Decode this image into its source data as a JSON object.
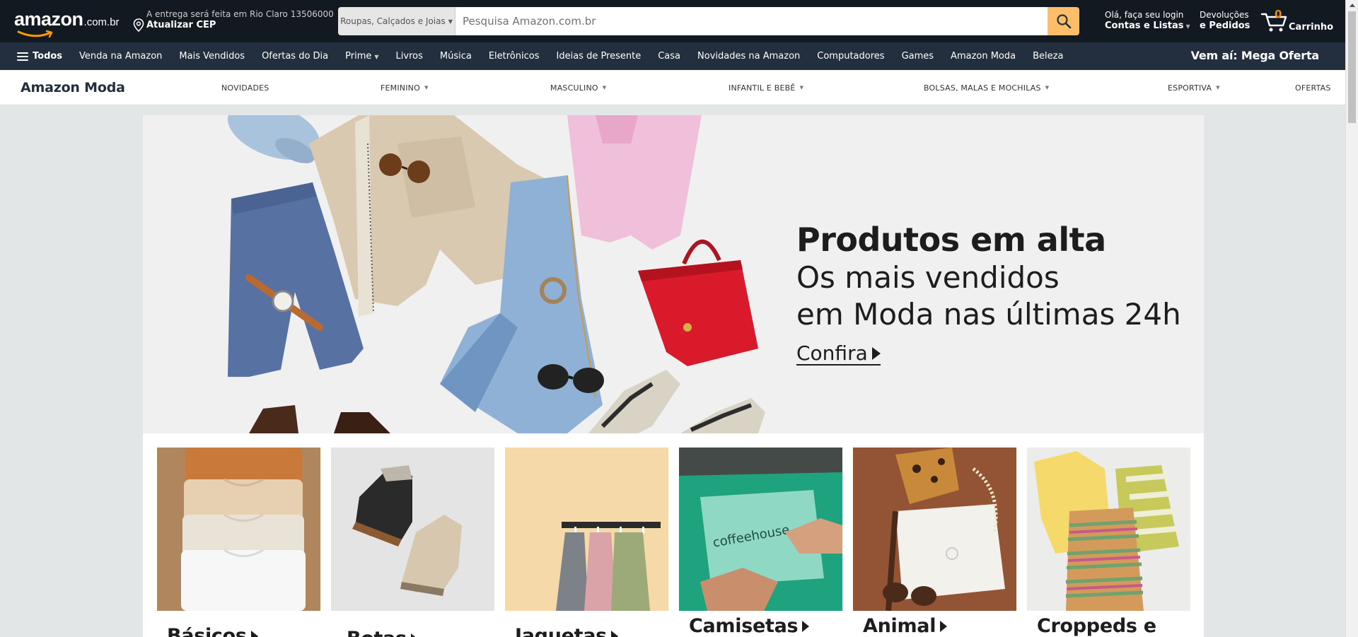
{
  "header": {
    "logo_word": "amazon",
    "logo_tld": ".com.br",
    "deliver_line1": "A entrega será feita em Rio Claro 13506000",
    "deliver_line2": "Atualizar CEP",
    "search_dept": "Roupas, Calçados e Joias",
    "search_placeholder": "Pesquisa Amazon.com.br",
    "account_line1": "Olá, faça seu login",
    "account_line2": "Contas e Listas",
    "returns_line1": "Devoluções",
    "returns_line2": "e Pedidos",
    "cart_count": "0",
    "cart_label": "Carrinho",
    "colors": {
      "nav_dark": "#131921",
      "nav_secondary": "#232f3e",
      "search_button": "#febd69",
      "cart_count": "#f08804"
    }
  },
  "nav": {
    "all_label": "Todos",
    "items": [
      "Venda na Amazon",
      "Mais Vendidos",
      "Ofertas do Dia",
      "Prime",
      "Livros",
      "Música",
      "Eletrônicos",
      "Ideias de Presente",
      "Casa",
      "Novidades na Amazon",
      "Computadores",
      "Games",
      "Amazon Moda",
      "Beleza"
    ],
    "promo": "Vem aí: Mega Oferta"
  },
  "subnav": {
    "brand": "Amazon Moda",
    "categories": [
      "NOVIDADES",
      "FEMININO",
      "MASCULINO",
      "INFANTIL E BEBÊ",
      "BOLSAS, MALAS E MOCHILAS",
      "ESPORTIVA",
      "OFERTAS"
    ]
  },
  "hero": {
    "title": "Produtos em alta",
    "subtitle_line1": "Os mais vendidos",
    "subtitle_line2": "em Moda nas últimas 24h",
    "cta": "Confira"
  },
  "cards": [
    {
      "label": "Básicos"
    },
    {
      "label": "Botas"
    },
    {
      "label": "Jaquetas"
    },
    {
      "label": "Camisetas"
    },
    {
      "label": "Animal"
    },
    {
      "label": "Croppeds e"
    }
  ]
}
